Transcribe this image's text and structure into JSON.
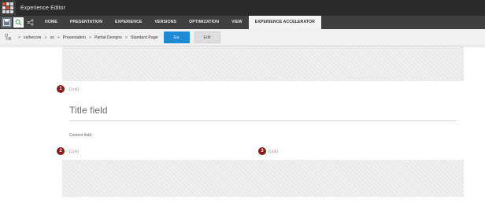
{
  "app": {
    "title": "Experience Editor"
  },
  "quick_access": {
    "icons": [
      "save-icon",
      "search-icon",
      "share-icon"
    ]
  },
  "tabs": [
    {
      "label": "HOME"
    },
    {
      "label": "PRESENTATION"
    },
    {
      "label": "EXPERIENCE"
    },
    {
      "label": "VERSIONS"
    },
    {
      "label": "OPTIMIZATION"
    },
    {
      "label": "VIEW"
    },
    {
      "label": "EXPERIENCE ACCELERATOR",
      "selected": true
    }
  ],
  "breadcrumb": {
    "separator": ">",
    "items": [
      "sxthecore",
      "sx",
      "Presentation",
      "Partial Designs",
      "Standard Page"
    ],
    "go_label": "Go",
    "edit_label": "Edit"
  },
  "canvas": {
    "markers": [
      "1",
      "2",
      "3"
    ],
    "link1": "[Link]",
    "link2": "[Link]",
    "link3": "[Link]",
    "title_field": "Title field",
    "content_field": "Content field"
  },
  "colors": {
    "title_bar": "#2b2b2b",
    "tab_bar": "#3f3f3f",
    "go_button": "#1e8ad6",
    "marker": "#8b1a1a"
  }
}
